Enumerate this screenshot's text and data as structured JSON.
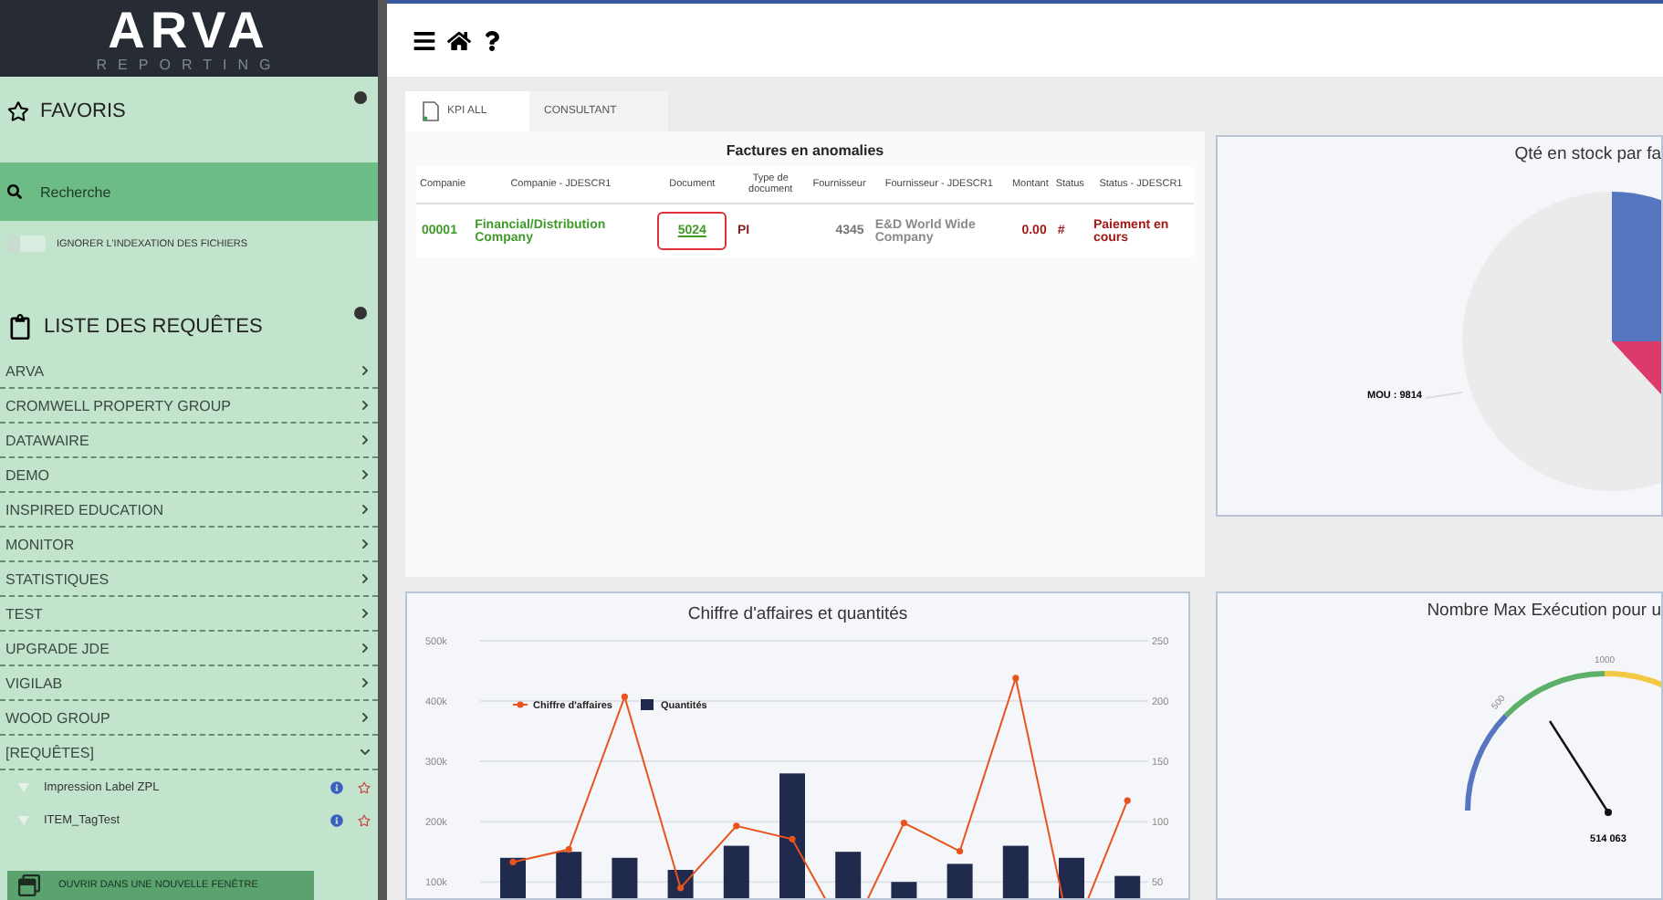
{
  "logo": {
    "name": "ARVA",
    "subtitle": "REPORTING"
  },
  "favorites": {
    "title": "FAVORIS"
  },
  "search": {
    "placeholder": "Recherche"
  },
  "index_toggle": {
    "label": "IGNORER L'INDEXATION DES FICHIERS",
    "on": false
  },
  "queries": {
    "title": "LISTE DES REQUÊTES",
    "items": [
      {
        "label": "ARVA",
        "expanded": false
      },
      {
        "label": "CROMWELL PROPERTY GROUP",
        "expanded": false
      },
      {
        "label": "DATAWAIRE",
        "expanded": false
      },
      {
        "label": "DEMO",
        "expanded": false
      },
      {
        "label": "INSPIRED EDUCATION",
        "expanded": false
      },
      {
        "label": "MONITOR",
        "expanded": false
      },
      {
        "label": "STATISTIQUES",
        "expanded": false
      },
      {
        "label": "TEST",
        "expanded": false
      },
      {
        "label": "UPGRADE JDE",
        "expanded": false
      },
      {
        "label": "VIGILAB",
        "expanded": false
      },
      {
        "label": "WOOD GROUP",
        "expanded": false
      },
      {
        "label": "[REQUÊTES]",
        "expanded": true,
        "children": [
          {
            "label": "Impression Label ZPL"
          },
          {
            "label": "ITEM_TagTest"
          }
        ]
      }
    ]
  },
  "open_window_button": {
    "label": "OUVRIR DANS UNE NOUVELLE FENÊTRE"
  },
  "tabs": [
    {
      "label": "KPI ALL",
      "selected": true
    },
    {
      "label": "CONSULTANT",
      "selected": false
    }
  ],
  "table": {
    "title": "Factures en anomalies",
    "columns": [
      "Companie",
      "Companie - JDESCR1",
      "Document",
      "Type de document",
      "Fournisseur",
      "Fournisseur - JDESCR1",
      "Montant",
      "Status",
      "Status - JDESCR1"
    ],
    "rows": [
      [
        {
          "text": "00001",
          "kind": "text",
          "color": "#3f9a2a"
        },
        {
          "text": "Financial/Distribution Company",
          "kind": "text",
          "color": "#3f9a2a"
        },
        {
          "text": "5024",
          "kind": "link",
          "color": "#3f9a2a",
          "highlighted": true
        },
        {
          "text": "PI",
          "kind": "text",
          "color": "#8a1a1a"
        },
        {
          "text": "4345",
          "kind": "number",
          "color": "#777777"
        },
        {
          "text": "E&D World Wide Company",
          "kind": "text",
          "color": "#8a8a8a"
        },
        {
          "text": "0.00",
          "kind": "number",
          "color": "#a01818"
        },
        {
          "text": "#",
          "kind": "text",
          "color": "#a01818"
        },
        {
          "text": "Paiement en cours",
          "kind": "text",
          "color": "#a01818"
        }
      ]
    ]
  },
  "pie": {
    "title": "Qté en stock par fa",
    "label": "MOU : 9814"
  },
  "combo": {
    "chart_data": {
      "type": "bar",
      "title": "Chiffre d'affaires et quantités",
      "grid": true,
      "legend": true,
      "series": [
        {
          "name": "Chiffre d'affaires",
          "color": "#e8541e",
          "type": "line",
          "marker": true,
          "values": [
            133000,
            154000,
            407000,
            90000,
            193000,
            171000,
            null,
            198000,
            151000,
            438000,
            null,
            235000
          ]
        },
        {
          "name": "Quantités",
          "color": "#1f2a4d",
          "axis": "y2",
          "values": [
            70,
            75,
            70,
            60,
            80,
            140,
            75,
            50,
            65,
            80,
            70,
            55
          ]
        }
      ],
      "ylim": [
        64000,
        500000
      ],
      "y2lim": [
        32,
        250
      ],
      "yticks": [
        {
          "value": 100000,
          "label": "100k"
        },
        {
          "value": 200000,
          "label": "200k"
        },
        {
          "value": 300000,
          "label": "300k"
        },
        {
          "value": 400000,
          "label": "400k"
        },
        {
          "value": 500000,
          "label": "500k"
        }
      ],
      "y2ticks": [
        50,
        100,
        150,
        200,
        250
      ]
    }
  },
  "gauge": {
    "title": "Nombre Max Exécution pour u",
    "tick_labels": [
      "500",
      "1000"
    ],
    "reading": "514 063"
  }
}
